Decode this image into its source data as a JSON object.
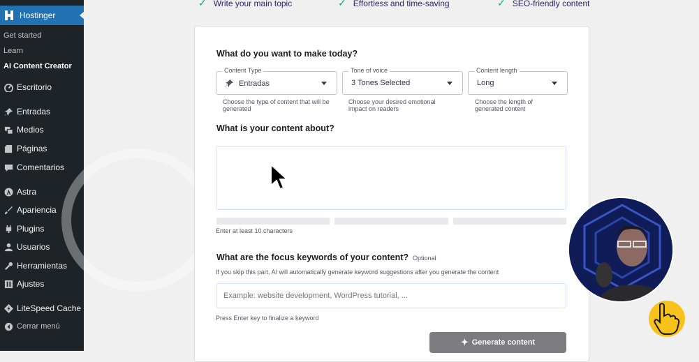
{
  "sidebar": {
    "brand": "Hostinger",
    "subitems": [
      "Get started",
      "Learn",
      "AI Content Creator"
    ],
    "items": [
      {
        "label": "Escritorio",
        "icon": "dashboard-icon"
      },
      {
        "label": "Entradas",
        "icon": "pin-icon"
      },
      {
        "label": "Medios",
        "icon": "media-icon"
      },
      {
        "label": "Páginas",
        "icon": "pages-icon"
      },
      {
        "label": "Comentarios",
        "icon": "comments-icon"
      },
      {
        "label": "Astra",
        "icon": "astra-icon"
      },
      {
        "label": "Apariencia",
        "icon": "appearance-icon"
      },
      {
        "label": "Plugins",
        "icon": "plugins-icon"
      },
      {
        "label": "Usuarios",
        "icon": "users-icon"
      },
      {
        "label": "Herramientas",
        "icon": "tools-icon"
      },
      {
        "label": "Ajustes",
        "icon": "settings-icon"
      },
      {
        "label": "LiteSpeed Cache",
        "icon": "litespeed-icon"
      },
      {
        "label": "Cerrar menú",
        "icon": "collapse-icon"
      }
    ]
  },
  "features": [
    "Write your main topic",
    "Effortless and time-saving",
    "SEO-friendly content"
  ],
  "form": {
    "title": "What do you want to make today?",
    "content_type": {
      "legend": "Content Type",
      "value": "Entradas",
      "help": "Choose the type of content that will be generated"
    },
    "tone": {
      "legend": "Tone of voice",
      "value": "3 Tones Selected",
      "help": "Choose your desired emotional impact on readers"
    },
    "length": {
      "legend": "Content length",
      "value": "Long",
      "help": "Choose the length of generated content"
    },
    "about_title": "What is your content about?",
    "about_hint": "Enter at least 10 characters",
    "keywords_title": "What are the focus keywords of your content?",
    "keywords_optional": "Optional",
    "keywords_desc": "If you skip this part, AI will automatically generate keyword suggestions after you generate the content",
    "keywords_placeholder": "Example: website development, WordPress tutorial, ...",
    "keywords_hint": "Press Enter key to finalize a keyword",
    "generate_label": "Generate content"
  },
  "colors": {
    "sidebar_bg": "#1d2327",
    "active": "#2271b1",
    "check": "#00b090",
    "button": "#7b7b80"
  }
}
